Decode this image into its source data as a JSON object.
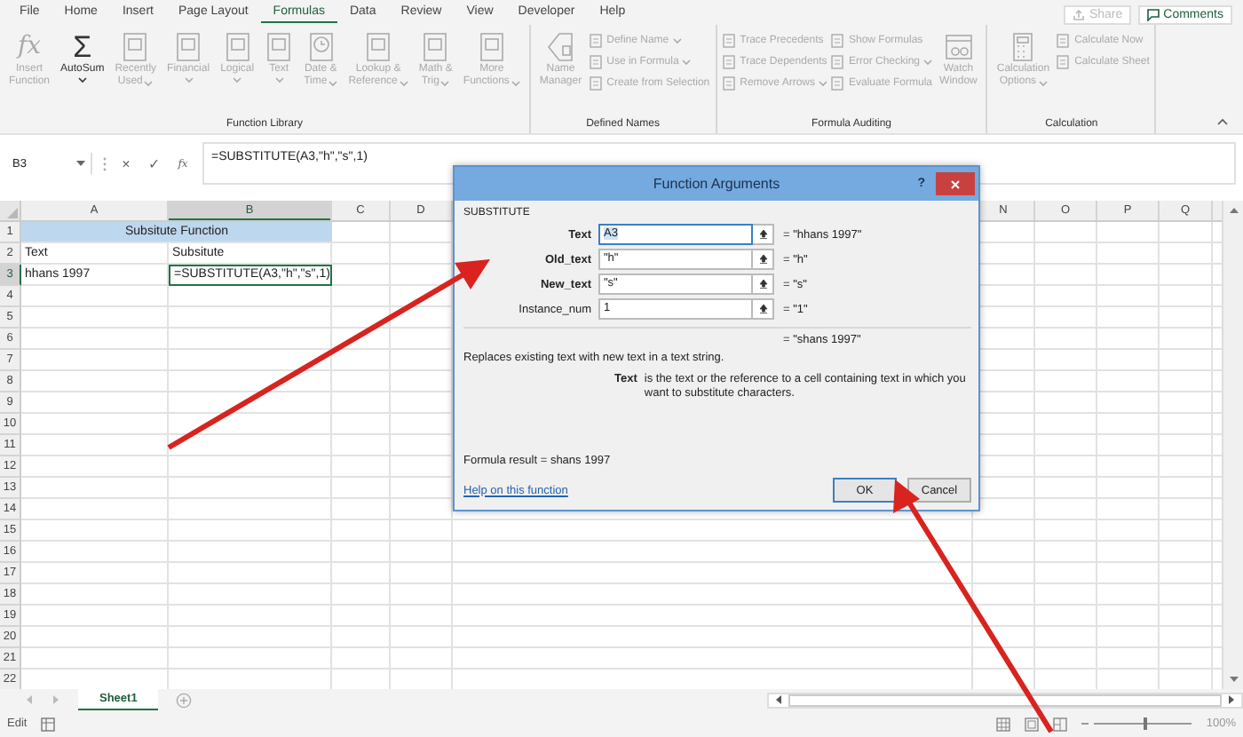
{
  "menu_tabs": [
    {
      "label": "File",
      "selected": false
    },
    {
      "label": "Home",
      "selected": false
    },
    {
      "label": "Insert",
      "selected": false
    },
    {
      "label": "Page Layout",
      "selected": false
    },
    {
      "label": "Formulas",
      "selected": true
    },
    {
      "label": "Data",
      "selected": false
    },
    {
      "label": "Review",
      "selected": false
    },
    {
      "label": "View",
      "selected": false
    },
    {
      "label": "Developer",
      "selected": false
    },
    {
      "label": "Help",
      "selected": false
    }
  ],
  "top_buttons": [
    {
      "kind": "share",
      "label": "Share",
      "disabled": true
    },
    {
      "kind": "comments",
      "label": "Comments",
      "disabled": false
    }
  ],
  "ribbon_groups": [
    {
      "label": "Function Library",
      "items": [
        {
          "kind": "large",
          "glyph": "fx",
          "lines": [
            "Insert",
            "Function"
          ],
          "dropdown": false,
          "disabled": true
        },
        {
          "kind": "large",
          "glyph": "Σ",
          "lines": [
            "AutoSum"
          ],
          "dropdown": true,
          "disabled": false
        },
        {
          "kind": "large",
          "lines": [
            "Recently",
            "Used"
          ],
          "dropdown": true,
          "disabled": true
        },
        {
          "kind": "large",
          "lines": [
            "Financial"
          ],
          "dropdown": true,
          "disabled": true
        },
        {
          "kind": "large",
          "lines": [
            "Logical"
          ],
          "dropdown": true,
          "disabled": true
        },
        {
          "kind": "large",
          "lines": [
            "Text"
          ],
          "dropdown": true,
          "disabled": true
        },
        {
          "kind": "large",
          "lines": [
            "Date &",
            "Time"
          ],
          "dropdown": true,
          "disabled": true
        },
        {
          "kind": "large",
          "lines": [
            "Lookup &",
            "Reference"
          ],
          "dropdown": true,
          "disabled": true
        },
        {
          "kind": "large",
          "lines": [
            "Math &",
            "Trig"
          ],
          "dropdown": true,
          "disabled": true
        },
        {
          "kind": "large",
          "lines": [
            "More",
            "Functions"
          ],
          "dropdown": true,
          "disabled": true
        }
      ]
    },
    {
      "label": "Defined Names",
      "items": [
        {
          "kind": "large",
          "lines": [
            "Name",
            "Manager"
          ],
          "dropdown": false,
          "disabled": true
        },
        {
          "kind": "stack",
          "buttons": [
            {
              "label": "Define Name",
              "dropdown": true,
              "disabled": true
            },
            {
              "label": "Use in Formula",
              "dropdown": true,
              "disabled": true
            },
            {
              "label": "Create from Selection",
              "dropdown": false,
              "disabled": true
            }
          ]
        }
      ]
    },
    {
      "label": "Formula Auditing",
      "items": [
        {
          "kind": "stack",
          "buttons": [
            {
              "label": "Trace Precedents",
              "dropdown": false,
              "disabled": true
            },
            {
              "label": "Trace Dependents",
              "dropdown": false,
              "disabled": true
            },
            {
              "label": "Remove Arrows",
              "dropdown": true,
              "disabled": true
            }
          ]
        },
        {
          "kind": "stack",
          "buttons": [
            {
              "label": "Show Formulas",
              "dropdown": false,
              "disabled": true
            },
            {
              "label": "Error Checking",
              "dropdown": true,
              "disabled": true
            },
            {
              "label": "Evaluate Formula",
              "dropdown": false,
              "disabled": true
            }
          ]
        },
        {
          "kind": "large",
          "lines": [
            "Watch",
            "Window"
          ],
          "dropdown": false,
          "disabled": true
        }
      ]
    },
    {
      "label": "Calculation",
      "items": [
        {
          "kind": "large",
          "lines": [
            "Calculation",
            "Options"
          ],
          "dropdown": true,
          "disabled": true
        },
        {
          "kind": "stack",
          "buttons": [
            {
              "label": "Calculate Now",
              "dropdown": false,
              "disabled": true
            },
            {
              "label": "Calculate Sheet",
              "dropdown": false,
              "disabled": true
            }
          ]
        }
      ]
    }
  ],
  "formula_bar": {
    "name_box": "B3",
    "cancel": "×",
    "enter": "✓",
    "insert_function": "fx",
    "formula": "=SUBSTITUTE(A3,\"h\",\"s\",1)"
  },
  "grid": {
    "columns": [
      {
        "label": "A",
        "selected": false
      },
      {
        "label": "B",
        "selected": true
      },
      {
        "label": "C",
        "selected": false
      },
      {
        "label": "D",
        "selected": false
      },
      {
        "label": "N",
        "selected": false
      },
      {
        "label": "O",
        "selected": false
      },
      {
        "label": "P",
        "selected": false
      },
      {
        "label": "Q",
        "selected": false
      }
    ],
    "rows": [
      {
        "number": "1",
        "selected": false,
        "cells": [
          {
            "kind": "banner",
            "text": "Subsitute Function",
            "selected": false
          }
        ]
      },
      {
        "number": "2",
        "selected": false,
        "cells": [
          {
            "kind": "plain",
            "text": "Text",
            "selected": false
          },
          {
            "kind": "plain",
            "text": "Subsitute",
            "selected": false
          }
        ]
      },
      {
        "number": "3",
        "selected": true,
        "cells": [
          {
            "kind": "plain",
            "text": "hhans  1997",
            "selected": false
          },
          {
            "kind": "plain",
            "text": "=SUBSTITUTE(A3,\"h\",\"s\",1)",
            "selected": true
          }
        ]
      },
      {
        "number": "4",
        "selected": false
      },
      {
        "number": "5",
        "selected": false
      },
      {
        "number": "6",
        "selected": false
      },
      {
        "number": "7",
        "selected": false
      },
      {
        "number": "8",
        "selected": false
      },
      {
        "number": "9",
        "selected": false
      },
      {
        "number": "10",
        "selected": false
      },
      {
        "number": "11",
        "selected": false
      },
      {
        "number": "12",
        "selected": false
      },
      {
        "number": "13",
        "selected": false
      },
      {
        "number": "14",
        "selected": false
      },
      {
        "number": "15",
        "selected": false
      },
      {
        "number": "16",
        "selected": false
      },
      {
        "number": "17",
        "selected": false
      },
      {
        "number": "18",
        "selected": false
      },
      {
        "number": "19",
        "selected": false
      },
      {
        "number": "20",
        "selected": false
      },
      {
        "number": "21",
        "selected": false
      },
      {
        "number": "22",
        "selected": false
      }
    ]
  },
  "sheet_tabs": [
    {
      "label": "Sheet1",
      "selected": true
    }
  ],
  "status_bar": {
    "mode": "Edit",
    "zoom": "100%",
    "zoom_slider": {
      "level": 0.5
    }
  },
  "dialog": {
    "title": "Function Arguments",
    "help": "?",
    "function_name": "SUBSTITUTE",
    "arguments": [
      {
        "label": "Text",
        "value": "A3",
        "result": "=  \"hhans  1997\"",
        "required": true,
        "focused": true
      },
      {
        "label": "Old_text",
        "value": "\"h\"",
        "result": "=  \"h\"",
        "required": true,
        "focused": false
      },
      {
        "label": "New_text",
        "value": "\"s\"",
        "result": "=  \"s\"",
        "required": true,
        "focused": false
      },
      {
        "label": "Instance_num",
        "value": "1",
        "result": "=  \"1\"",
        "required": false,
        "focused": false
      }
    ],
    "result": "=  \"shans  1997\"",
    "description": "Replaces existing text with new text in a text string.",
    "argument_help": {
      "name": "Text",
      "text": "is the text or the reference to a cell containing text in which you want to substitute characters."
    },
    "formula_result": "Formula result =   shans  1997",
    "help_link": "Help on this function",
    "buttons": [
      {
        "label": "OK",
        "default": true
      },
      {
        "label": "Cancel",
        "default": false
      }
    ]
  }
}
